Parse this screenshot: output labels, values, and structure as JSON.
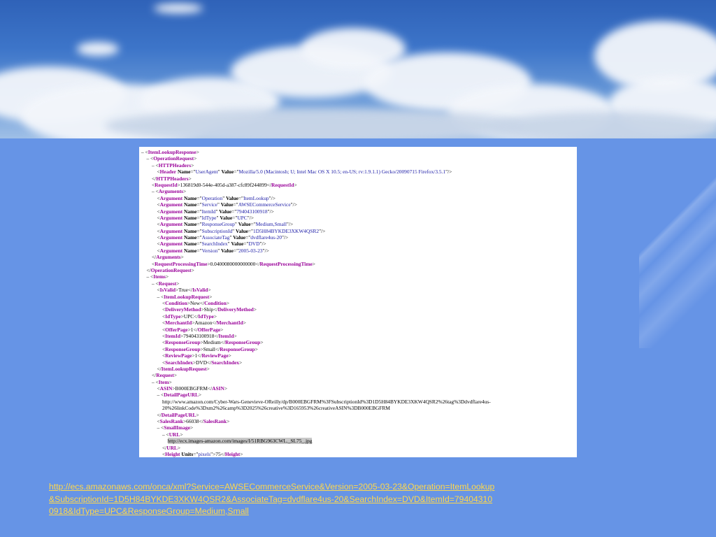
{
  "xml_view": {
    "lines": [
      {
        "indent": 0,
        "html": "<span class='mk'>– </span><span class='mk'>&lt;</span><span class='tg'>ItemLookupResponse</span><span class='mk'>&gt;</span>"
      },
      {
        "indent": 1,
        "html": "<span class='mk'>– &lt;</span><span class='tg'>OperationRequest</span><span class='mk'>&gt;</span>"
      },
      {
        "indent": 2,
        "html": "<span class='mk'>– &lt;</span><span class='tg'>HTTPHeaders</span><span class='mk'>&gt;</span>"
      },
      {
        "indent": 3,
        "html": "<span class='mk'>&lt;</span><span class='tg'>Header</span> <span class='at'>Name</span>=\"<span class='av'>UserAgent</span>\" <span class='at'>Value</span>=\"<span class='av'>Mozilla/5.0 (Macintosh; U; Intel Mac OS X 10.5; en-US; rv:1.9.1.1) Gecko/20090715 Firefox/3.5.1</span>\"/&gt;"
      },
      {
        "indent": 2,
        "html": "&lt;/<span class='tg'>HTTPHeaders</span>&gt;"
      },
      {
        "indent": 2,
        "html": "&lt;<span class='tg'>RequestId</span>&gt;136819d0-544e-405d-a387-cfc89f244899&lt;/<span class='tg'>RequestId</span>&gt;"
      },
      {
        "indent": 2,
        "html": "– &lt;<span class='tg'>Arguments</span>&gt;"
      },
      {
        "indent": 3,
        "html": "&lt;<span class='tg'>Argument</span> <span class='at'>Name</span>=\"<span class='av'>Operation</span>\" <span class='at'>Value</span>=\"<span class='av'>ItemLookup</span>\"/&gt;"
      },
      {
        "indent": 3,
        "html": "&lt;<span class='tg'>Argument</span> <span class='at'>Name</span>=\"<span class='av'>Service</span>\" <span class='at'>Value</span>=\"<span class='av'>AWSECommerceService</span>\"/&gt;"
      },
      {
        "indent": 3,
        "html": "&lt;<span class='tg'>Argument</span> <span class='at'>Name</span>=\"<span class='av'>ItemId</span>\" <span class='at'>Value</span>=\"<span class='av'>794043100918</span>\"/&gt;"
      },
      {
        "indent": 3,
        "html": "&lt;<span class='tg'>Argument</span> <span class='at'>Name</span>=\"<span class='av'>IdType</span>\" <span class='at'>Value</span>=\"<span class='av'>UPC</span>\"/&gt;"
      },
      {
        "indent": 3,
        "html": "&lt;<span class='tg'>Argument</span> <span class='at'>Name</span>=\"<span class='av'>ResponseGroup</span>\" <span class='at'>Value</span>=\"<span class='av'>Medium,Small</span>\"/&gt;"
      },
      {
        "indent": 3,
        "html": "&lt;<span class='tg'>Argument</span> <span class='at'>Name</span>=\"<span class='av'>SubscriptionId</span>\" <span class='at'>Value</span>=\"<span class='av'>1D5H84BYKDE3XKW4QSR2</span>\"/&gt;"
      },
      {
        "indent": 3,
        "html": "&lt;<span class='tg'>Argument</span> <span class='at'>Name</span>=\"<span class='av'>AssociateTag</span>\" <span class='at'>Value</span>=\"<span class='av'>dvdflare4us-20</span>\"/&gt;"
      },
      {
        "indent": 3,
        "html": "&lt;<span class='tg'>Argument</span> <span class='at'>Name</span>=\"<span class='av'>SearchIndex</span>\" <span class='at'>Value</span>=\"<span class='av'>DVD</span>\"/&gt;"
      },
      {
        "indent": 3,
        "html": "&lt;<span class='tg'>Argument</span> <span class='at'>Name</span>=\"<span class='av'>Version</span>\" <span class='at'>Value</span>=\"<span class='av'>2005-03-23</span>\"/&gt;"
      },
      {
        "indent": 2,
        "html": "&lt;/<span class='tg'>Arguments</span>&gt;"
      },
      {
        "indent": 2,
        "html": "&lt;<span class='tg'>RequestProcessingTime</span>&gt;0.0400080000000000&lt;/<span class='tg'>RequestProcessingTime</span>&gt;"
      },
      {
        "indent": 1,
        "html": "&lt;/<span class='tg'>OperationRequest</span>&gt;"
      },
      {
        "indent": 1,
        "html": "– &lt;<span class='tg'>Items</span>&gt;"
      },
      {
        "indent": 2,
        "html": "– &lt;<span class='tg'>Request</span>&gt;"
      },
      {
        "indent": 3,
        "html": "&lt;<span class='tg'>IsValid</span>&gt;True&lt;/<span class='tg'>IsValid</span>&gt;"
      },
      {
        "indent": 3,
        "html": "– &lt;<span class='tg'>ItemLookupRequest</span>&gt;"
      },
      {
        "indent": 4,
        "html": "&lt;<span class='tg'>Condition</span>&gt;New&lt;/<span class='tg'>Condition</span>&gt;"
      },
      {
        "indent": 4,
        "html": "&lt;<span class='tg'>DeliveryMethod</span>&gt;Ship&lt;/<span class='tg'>DeliveryMethod</span>&gt;"
      },
      {
        "indent": 4,
        "html": "&lt;<span class='tg'>IdType</span>&gt;UPC&lt;/<span class='tg'>IdType</span>&gt;"
      },
      {
        "indent": 4,
        "html": "&lt;<span class='tg'>MerchantId</span>&gt;Amazon&lt;/<span class='tg'>MerchantId</span>&gt;"
      },
      {
        "indent": 4,
        "html": "&lt;<span class='tg'>OfferPage</span>&gt;1&lt;/<span class='tg'>OfferPage</span>&gt;"
      },
      {
        "indent": 4,
        "html": "&lt;<span class='tg'>ItemId</span>&gt;794043100918&lt;/<span class='tg'>ItemId</span>&gt;"
      },
      {
        "indent": 4,
        "html": "&lt;<span class='tg'>ResponseGroup</span>&gt;Medium&lt;/<span class='tg'>ResponseGroup</span>&gt;"
      },
      {
        "indent": 4,
        "html": "&lt;<span class='tg'>ResponseGroup</span>&gt;Small&lt;/<span class='tg'>ResponseGroup</span>&gt;"
      },
      {
        "indent": 4,
        "html": "&lt;<span class='tg'>ReviewPage</span>&gt;1&lt;/<span class='tg'>ReviewPage</span>&gt;"
      },
      {
        "indent": 4,
        "html": "&lt;<span class='tg'>SearchIndex</span>&gt;DVD&lt;/<span class='tg'>SearchIndex</span>&gt;"
      },
      {
        "indent": 3,
        "html": "&lt;/<span class='tg'>ItemLookupRequest</span>&gt;"
      },
      {
        "indent": 2,
        "html": "&lt;/<span class='tg'>Request</span>&gt;"
      },
      {
        "indent": 2,
        "html": "– &lt;<span class='tg'>Item</span>&gt;"
      },
      {
        "indent": 3,
        "html": "&lt;<span class='tg'>ASIN</span>&gt;B000EBGFRM&lt;/<span class='tg'>ASIN</span>&gt;"
      },
      {
        "indent": 3,
        "html": "– &lt;<span class='tg'>DetailPageURL</span>&gt;"
      },
      {
        "indent": 4,
        "wrap": true,
        "html": "http://www.amazon.com/Cyber-Wars-Genevieve-OReilly/dp/B000EBGFRM%3FSubscriptionId%3D1D5H84BYKDE3XKW4QSR2%26tag%3Ddvdflare4us-20%26linkCode%3Dxm2%26camp%3D2025%26creative%3D165953%26creativeASIN%3DB000EBGFRM"
      },
      {
        "indent": 3,
        "html": "&lt;/<span class='tg'>DetailPageURL</span>&gt;"
      },
      {
        "indent": 3,
        "html": "&lt;<span class='tg'>SalesRank</span>&gt;66038&lt;/<span class='tg'>SalesRank</span>&gt;"
      },
      {
        "indent": 3,
        "html": "– &lt;<span class='tg'>SmallImage</span>&gt;"
      },
      {
        "indent": 4,
        "html": "– &lt;<span class='tg'>URL</span>&gt;"
      },
      {
        "indent": 5,
        "html": "<span class='hl'>http://ecx.images-amazon.com/images/I/51RBG963CWL._SL75_.jpg</span>"
      },
      {
        "indent": 4,
        "html": "&lt;/<span class='tg'>URL</span>&gt;"
      },
      {
        "indent": 4,
        "html": "&lt;<span class='tg'>Height</span> <span class='at'>Units</span>=\"<span class='av'>pixels</span>\"&gt;75&lt;/<span class='tg'>Height</span>&gt;"
      }
    ]
  },
  "footer_link": {
    "text": "http://ecs.amazonaws.com/onca/xml?Service=AWSECommerceService&Version=2005-03-23&Operation=ItemLookup&SubscriptionId=1D5H84BYKDE3XKW4QSR2&AssociateTag=dvdflare4us-20&SearchIndex=DVD&ItemId=794043100918&IdType=UPC&ResponseGroup=Medium,Small"
  }
}
